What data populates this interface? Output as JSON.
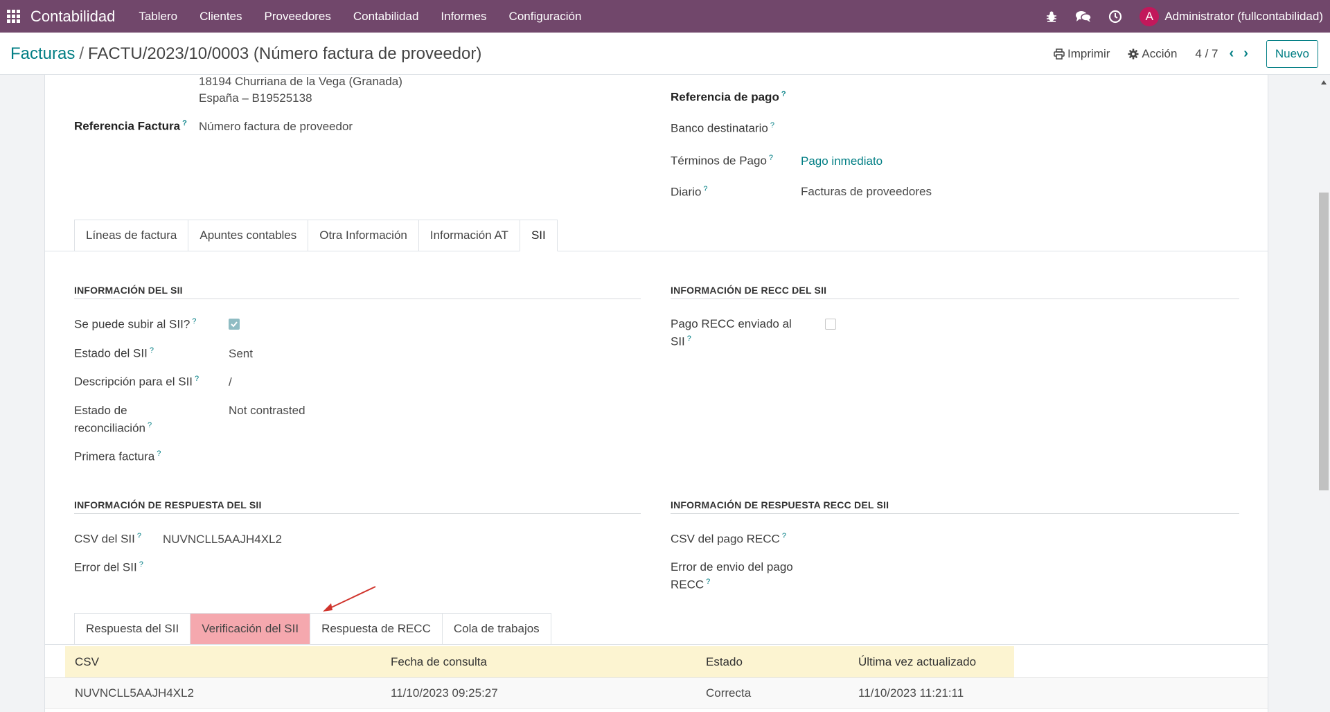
{
  "navbar": {
    "brand": "Contabilidad",
    "menu": [
      "Tablero",
      "Clientes",
      "Proveedores",
      "Contabilidad",
      "Informes",
      "Configuración"
    ],
    "avatar_letter": "A",
    "user": "Administrator (fullcontabilidad)"
  },
  "control_panel": {
    "breadcrumb_parent": "Facturas",
    "breadcrumb_separator": "/",
    "breadcrumb_current": "FACTU/2023/10/0003 (Número factura de proveedor)",
    "print_label": "Imprimir",
    "action_label": "Acción",
    "pager": "4 / 7",
    "new_label": "Nuevo"
  },
  "header_fields": {
    "address_line1": "18194 Churriana de la Vega (Granada)",
    "address_line2": "España – B19525138",
    "ref_label": "Referencia Factura",
    "ref_value": "Número factura de proveedor",
    "payment_ref_label": "Referencia de pago",
    "bank_label": "Banco destinatario",
    "terms_label": "Términos de Pago",
    "terms_value": "Pago inmediato",
    "journal_label": "Diario",
    "journal_value": "Facturas de proveedores",
    "help_mark": "?"
  },
  "main_tabs": [
    "Líneas de factura",
    "Apuntes contables",
    "Otra Información",
    "Información AT",
    "SII"
  ],
  "sii_info": {
    "title": "INFORMACIÓN DEL SII",
    "can_upload_label": "Se puede subir al SII?",
    "can_upload_checked": true,
    "state_label": "Estado del SII",
    "state_value": "Sent",
    "description_label": "Descripción para el SII",
    "description_value": "/",
    "reconcile_label_1": "Estado de",
    "reconcile_label_2": "reconciliación",
    "reconcile_value": "Not contrasted",
    "first_invoice_label": "Primera factura"
  },
  "recc_info": {
    "title": "INFORMACIÓN DE RECC DEL SII",
    "sent_label_1": "Pago RECC enviado al",
    "sent_label_2": "SII",
    "sent_checked": false
  },
  "sii_response": {
    "title": "INFORMACIÓN DE RESPUESTA DEL SII",
    "csv_label": "CSV del SII",
    "csv_value": "NUVNCLL5AAJH4XL2",
    "error_label": "Error del SII"
  },
  "recc_response": {
    "title": "INFORMACIÓN DE RESPUESTA RECC DEL SII",
    "csv_label": "CSV del pago RECC",
    "error_label_1": "Error de envio del pago",
    "error_label_2": "RECC"
  },
  "sub_tabs": [
    "Respuesta del SII",
    "Verificación del SII",
    "Respuesta de RECC",
    "Cola de trabajos"
  ],
  "verification_table": {
    "columns": [
      "CSV",
      "Fecha de consulta",
      "Estado",
      "Última vez actualizado"
    ],
    "rows": [
      [
        "NUVNCLL5AAJH4XL2",
        "11/10/2023 09:25:27",
        "Correcta",
        "11/10/2023 11:21:11"
      ]
    ]
  },
  "colors": {
    "navbar": "#71476b",
    "accent": "#017e84",
    "highlight_tab": "#f5a8ae",
    "table_header": "#fcf4d1",
    "annotation_arrow": "#d0342c"
  }
}
